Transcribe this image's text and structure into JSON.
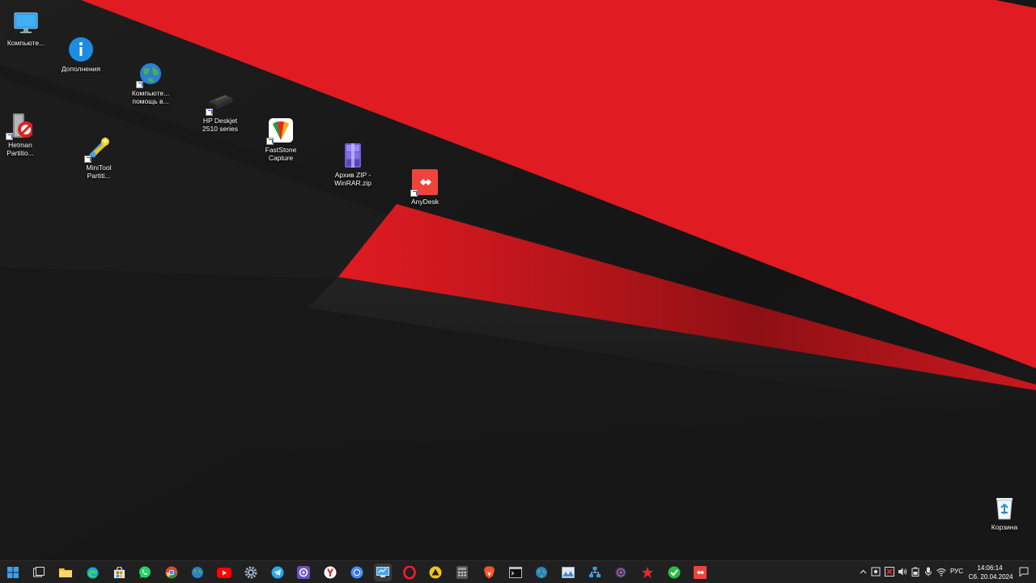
{
  "desktop": {
    "icons": [
      {
        "label": "Компьюте...",
        "icon": "monitor-icon"
      },
      {
        "label": "Дополнения",
        "icon": "info-icon"
      },
      {
        "label": "Компьюте...\nпомощь в...",
        "icon": "globe-icon"
      },
      {
        "label": "HP Deskjet\n2510 series",
        "icon": "printer-icon"
      },
      {
        "label": "Hetman\nPartitio...",
        "icon": "hetman-partition-icon"
      },
      {
        "label": "MiniTool\nPartiti...",
        "icon": "minitool-icon"
      },
      {
        "label": "FastStone\nCapture",
        "icon": "faststone-capture-icon"
      },
      {
        "label": "Архив ZIP -\nWinRAR.zip",
        "icon": "winrar-archive-icon"
      },
      {
        "label": "AnyDesk",
        "icon": "anydesk-icon"
      },
      {
        "label": "Корзина",
        "icon": "recycle-bin-icon"
      }
    ]
  },
  "taskbar": {
    "apps": [
      "start-icon",
      "task-view-icon",
      "file-explorer-icon",
      "edge-icon",
      "store-icon",
      "whatsapp-icon",
      "chrome-icon",
      "globe-app-icon",
      "youtube-icon",
      "settings-icon",
      "telegram-icon",
      "purple-app-icon",
      "yandex-icon",
      "chromium-icon",
      "monitor-app-icon",
      "opera-icon",
      "warning-app-icon",
      "calculator-icon",
      "brave-icon",
      "terminal-icon",
      "globe-app-2-icon",
      "image-viewer-icon",
      "network-app-icon",
      "dark-app-icon",
      "red-app-icon",
      "checkmark-app-icon",
      "anydesk-taskbar-icon"
    ],
    "active_app_index": 14,
    "tray": {
      "language": "РУС",
      "time": "14:06:14",
      "date": "Сб. 20.04.2024",
      "icons": [
        "chevron-up-icon",
        "screen-capture-icon",
        "red-tray-icon",
        "volume-icon",
        "battery-icon",
        "microphone-icon",
        "wifi-icon",
        "notification-icon"
      ]
    }
  },
  "colors": {
    "wallpaper_red": "#e01b22",
    "wallpaper_dark": "#161616",
    "taskbar_bg": "#202020"
  }
}
